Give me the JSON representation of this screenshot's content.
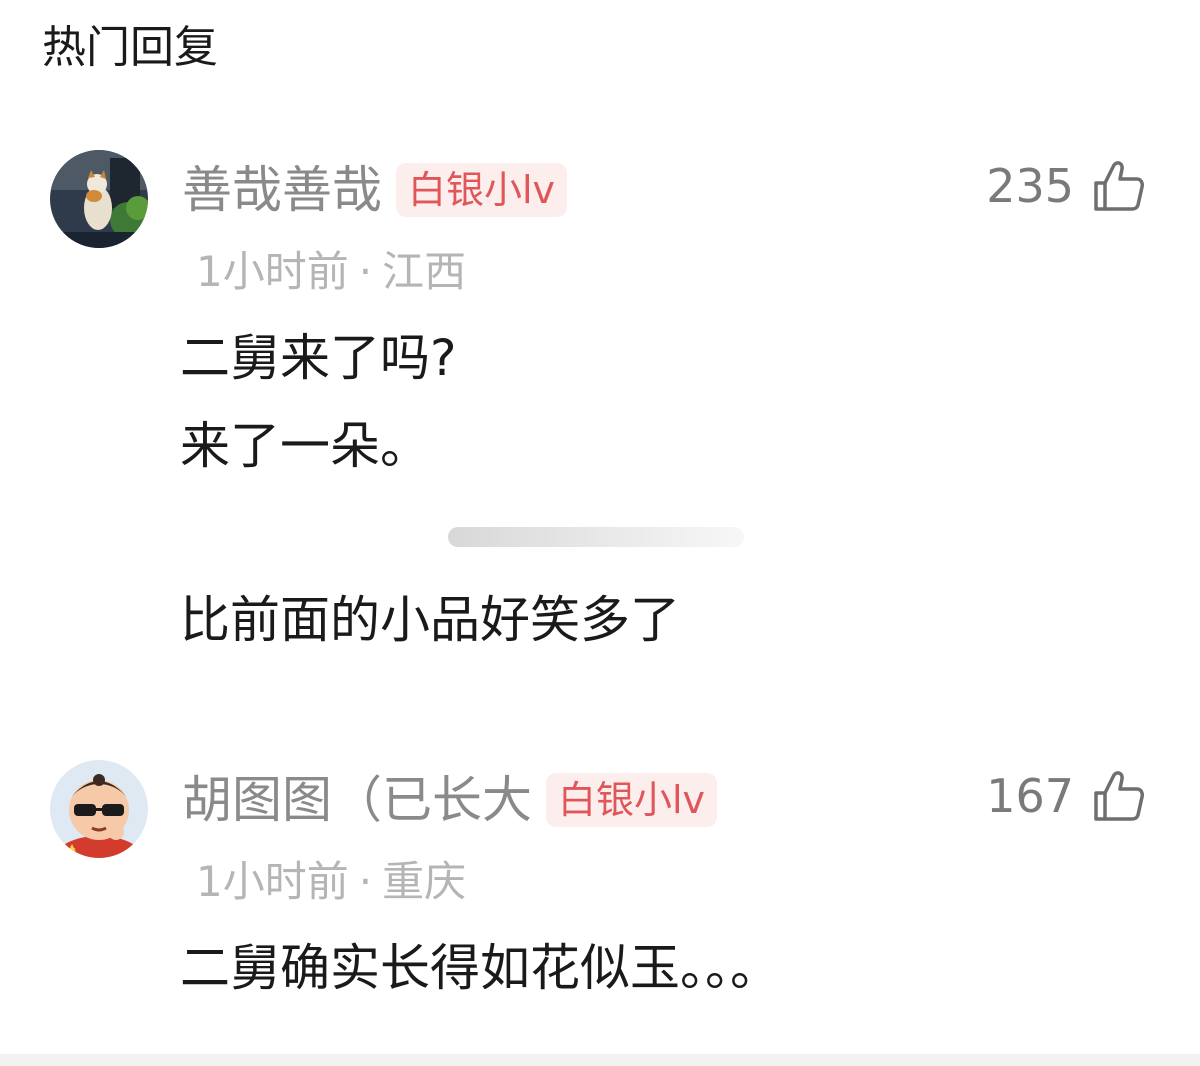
{
  "section": {
    "title": "热门回复"
  },
  "comments": [
    {
      "username": "善哉善哉",
      "badge": "白银小lv",
      "time": "1小时前",
      "separator": "·",
      "location": "江西",
      "likes": "235",
      "lines": [
        "二舅来了吗?",
        "来了一朵。",
        "比前面的小品好笑多了"
      ]
    },
    {
      "username": "胡图图（已长大",
      "badge": "白银小lv",
      "time": "1小时前",
      "separator": "·",
      "location": "重庆",
      "likes": "167",
      "lines": [
        "二舅确实长得如花似玉。。。"
      ]
    }
  ],
  "colors": {
    "badge_bg": "#fdeeee",
    "badge_text": "#e0575a",
    "username": "#8a8a8a",
    "meta": "#b5b5b5"
  },
  "icons": {
    "like": "thumbs-up-icon"
  }
}
